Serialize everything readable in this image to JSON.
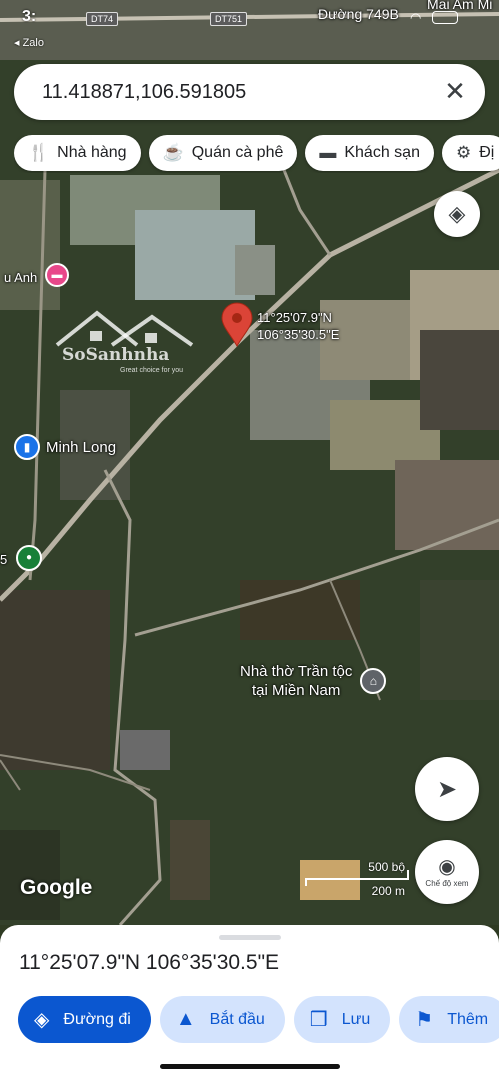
{
  "status_bar": {
    "time": "3:",
    "back_label": "◂ Zalo"
  },
  "map": {
    "road_labels": [
      "Đường 749B",
      "Mai Am Mi",
      "Đường"
    ],
    "road_badges": [
      "DT751",
      "DT74"
    ],
    "place_labels": {
      "left_edge": "u Anh",
      "left_small": "5"
    },
    "watermark": {
      "brand": "SoSanhnha",
      "tagline": "Great choice for you"
    },
    "pin": {
      "lat": "11°25'07.9\"N",
      "lng": "106°35'30.5\"E"
    },
    "pois": [
      {
        "name": "Minh Long",
        "icon": "bookmark-icon",
        "color": "#1a73e8"
      },
      {
        "name": "Nhà thờ Trần tộc\ntại Miền Nam",
        "icon": "church-icon",
        "color": "#5f6368"
      }
    ],
    "google_logo": "Google",
    "scale": {
      "imperial": "500 bộ",
      "metric": "200 m"
    },
    "street_view_label": "Chế độ xem"
  },
  "search": {
    "query": "11.418871,106.591805",
    "close_icon": "close-icon"
  },
  "chips": [
    {
      "label": "Nhà hàng",
      "icon": "restaurant-icon"
    },
    {
      "label": "Quán cà phê",
      "icon": "coffee-icon"
    },
    {
      "label": "Khách sạn",
      "icon": "hotel-icon"
    },
    {
      "label": "Đị",
      "icon": "gear-icon"
    }
  ],
  "sheet": {
    "coordinates": "11°25'07.9\"N 106°35'30.5\"E",
    "actions": [
      {
        "label": "Đường đi",
        "icon": "directions-icon",
        "primary": true
      },
      {
        "label": "Bắt đầu",
        "icon": "navigation-icon",
        "primary": false
      },
      {
        "label": "Lưu",
        "icon": "bookmark-icon",
        "primary": false
      },
      {
        "label": "Thêm",
        "icon": "flag-icon",
        "primary": false
      }
    ]
  },
  "colors": {
    "accent": "#0b57d0",
    "pin": "#db4437",
    "tonal": "#d3e3fd"
  }
}
